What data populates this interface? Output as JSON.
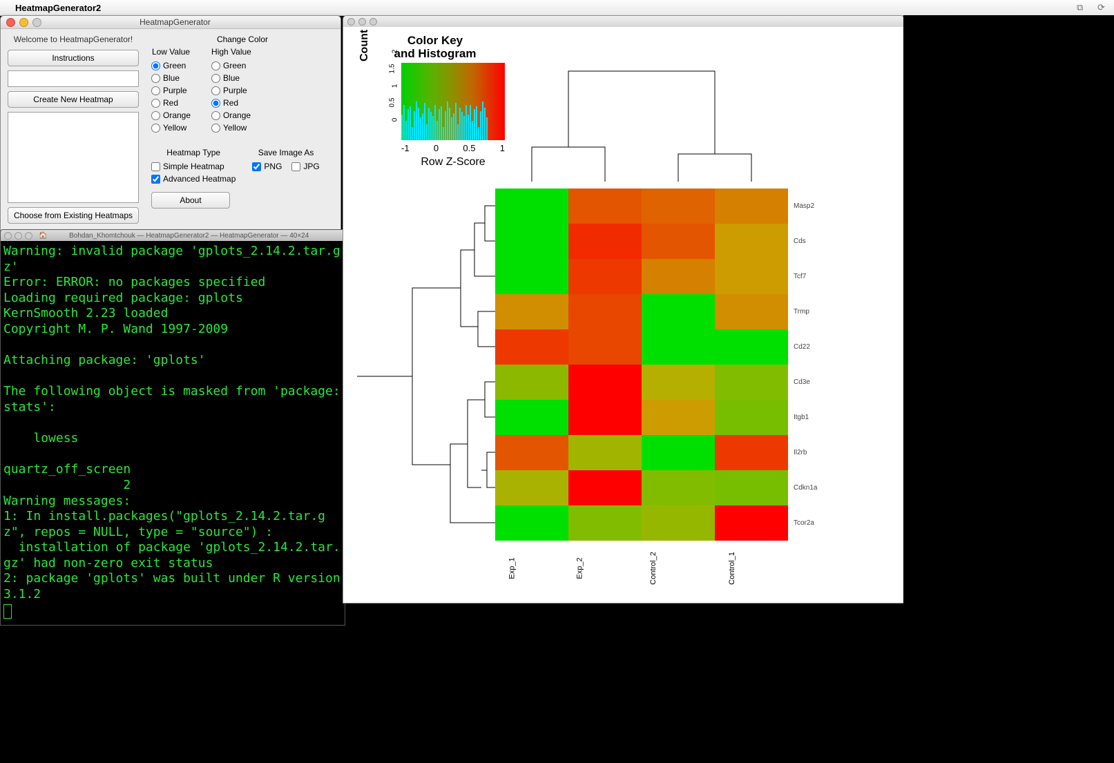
{
  "menubar": {
    "app": "HeatmapGenerator2"
  },
  "ctrl": {
    "window_title": "HeatmapGenerator",
    "welcome": "Welcome to HeatmapGenerator!",
    "instructions_btn": "Instructions",
    "create_btn": "Create New Heatmap",
    "choose_btn": "Choose from Existing Heatmaps",
    "change_color": "Change Color",
    "low_label": "Low Value",
    "high_label": "High Value",
    "colors": [
      "Green",
      "Blue",
      "Purple",
      "Red",
      "Orange",
      "Yellow"
    ],
    "low_selected": "Green",
    "high_selected": "Red",
    "heatmap_type_label": "Heatmap Type",
    "type_simple": "Simple Heatmap",
    "type_advanced": "Advanced Heatmap",
    "type_selected": "Advanced Heatmap",
    "save_label": "Save Image As",
    "save_png": "PNG",
    "save_jpg": "JPG",
    "save_png_checked": true,
    "save_jpg_checked": false,
    "about_btn": "About"
  },
  "terminal": {
    "title": "Bohdan_Khomtchouk — HeatmapGenerator2 — HeatmapGenerator — 40×24",
    "text": "Warning: invalid package 'gplots_2.14.2.tar.gz'\nError: ERROR: no packages specified\nLoading required package: gplots\nKernSmooth 2.23 loaded\nCopyright M. P. Wand 1997-2009\n\nAttaching package: 'gplots'\n\nThe following object is masked from 'package:stats':\n\n    lowess\n\nquartz_off_screen \n                2 \nWarning messages:\n1: In install.packages(\"gplots_2.14.2.tar.gz\", repos = NULL, type = \"source\") :\n  installation of package 'gplots_2.14.2.tar.gz' had non-zero exit status\n2: package 'gplots' was built under R version 3.1.2"
  },
  "chart_data": {
    "type": "heatmap",
    "color_key": {
      "title": "Color Key\nand Histogram",
      "ylabel": "Count",
      "xlabel": "Row Z-Score",
      "xticks": [
        "-1",
        "0",
        "0.5",
        "1"
      ],
      "yticks": [
        "0",
        "0.5",
        "1",
        "1.5",
        "2"
      ],
      "gradient_low": "#00d000",
      "gradient_high": "#ff0000",
      "hist_heights": [
        40,
        55,
        30,
        48,
        52,
        20,
        45,
        60,
        50,
        35,
        42,
        58,
        25,
        50,
        44,
        38,
        55,
        30,
        48,
        52,
        20,
        45,
        60,
        50,
        35,
        42,
        58,
        25,
        50,
        44,
        38,
        55,
        40,
        55,
        30,
        48,
        52,
        20,
        45,
        60,
        50,
        35
      ]
    },
    "columns": [
      "Exp_1",
      "Exp_2",
      "Control_2",
      "Control_1"
    ],
    "rows": [
      "Masp2",
      "Cds",
      "Tcf7",
      "Trmp",
      "Cd22",
      "Cd3e",
      "Itgb1",
      "Il2rb",
      "Cdkn1a",
      "Tcor2a"
    ],
    "z_scores": [
      [
        -1.2,
        0.6,
        0.5,
        0.3
      ],
      [
        -1.1,
        0.9,
        0.6,
        0.1
      ],
      [
        -1.0,
        0.8,
        0.3,
        0.1
      ],
      [
        0.2,
        0.7,
        -1.0,
        0.2
      ],
      [
        0.8,
        0.7,
        -1.1,
        -0.9
      ],
      [
        -0.6,
        1.1,
        -0.2,
        -0.7
      ],
      [
        -0.9,
        1.0,
        0.1,
        -0.8
      ],
      [
        0.6,
        -0.4,
        -1.1,
        0.8
      ],
      [
        -0.3,
        1.2,
        -0.7,
        -0.8
      ],
      [
        -0.9,
        -0.7,
        -0.5,
        1.0
      ]
    ]
  }
}
